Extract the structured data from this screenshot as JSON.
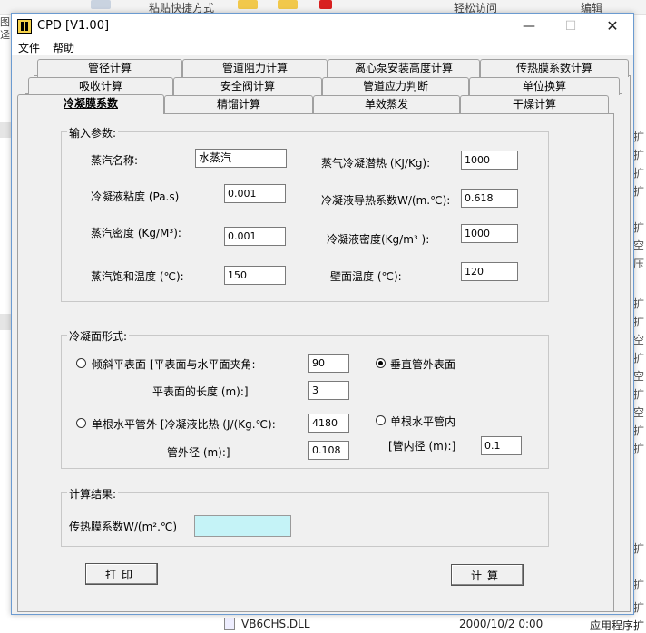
{
  "background": {
    "top_items": [
      "粘贴快捷方式",
      "轻松访问",
      "编辑"
    ],
    "left_partial": [
      "图",
      "迳"
    ],
    "right_partial": [
      "扩",
      "扩",
      "扩",
      "扩",
      "扩",
      "空",
      "压",
      "扩",
      "扩",
      "空",
      "扩",
      "空",
      "扩",
      "空",
      "扩",
      "扩",
      "扩",
      "扩",
      "扩"
    ],
    "file_name": "VB6CHS.DLL",
    "file_date": "2000/10/2 0:00",
    "file_type": "应用程序扩"
  },
  "window": {
    "title": "CPD [V1.00]",
    "min_glyph": "—",
    "max_glyph": "☐",
    "close_glyph": "✕"
  },
  "menu": [
    "文件",
    "帮助"
  ],
  "tabs": {
    "row1": [
      "管径计算",
      "管道阻力计算",
      "离心泵安装高度计算",
      "传热膜系数计算"
    ],
    "row2": [
      "吸收计算",
      "安全阀计算",
      "管道应力判断",
      "单位换算"
    ],
    "row3": [
      "冷凝膜系数",
      "精馏计算",
      "单效蒸发",
      "干燥计算"
    ],
    "active": "冷凝膜系数"
  },
  "input_group": {
    "title": "输入参数:",
    "steam_name_label": "蒸汽名称:",
    "steam_name_value": "水蒸汽",
    "latent_heat_label": "蒸气冷凝潜热 (KJ/Kg):",
    "latent_heat_value": "1000",
    "viscosity_label": "冷凝液粘度 (Pa.s)",
    "viscosity_value": "0.001",
    "conductivity_label": "冷凝液导热系数W/(m.℃):",
    "conductivity_value": "0.618",
    "vapor_density_label": "蒸汽密度 (Kg/M³):",
    "vapor_density_value": "0.001",
    "liquid_density_label": "冷凝液密度(Kg/m³ ):",
    "liquid_density_value": "1000",
    "sat_temp_label": "蒸汽饱和温度 (℃):",
    "sat_temp_value": "150",
    "wall_temp_label": "壁面温度 (℃):",
    "wall_temp_value": "120"
  },
  "surface_group": {
    "title": "冷凝面形式:",
    "inclined_label": "倾斜平表面 [平表面与水平面夹角:",
    "inclined_angle": "90",
    "plane_length_label": "平表面的长度 (m):]",
    "plane_length_value": "3",
    "vertical_label": "垂直管外表面",
    "vertical_checked": true,
    "horiz_out_label": "单根水平管外 [冷凝液比热 (J/(Kg.℃):",
    "specific_heat_value": "4180",
    "outer_dia_label": "管外径 (m):]",
    "outer_dia_value": "0.108",
    "horiz_in_label": "单根水平管内",
    "inner_dia_label": "[管内径 (m):]",
    "inner_dia_value": "0.1"
  },
  "result_group": {
    "title": "计算结果:",
    "coef_label": "传热膜系数W/(m².℃)",
    "coef_value": ""
  },
  "buttons": {
    "print": "打印",
    "calc": "计算"
  },
  "colors": {
    "result_bg": "#c5f3f7",
    "window_bg": "#f0f0f0",
    "frame_border": "#6b9bd1"
  }
}
